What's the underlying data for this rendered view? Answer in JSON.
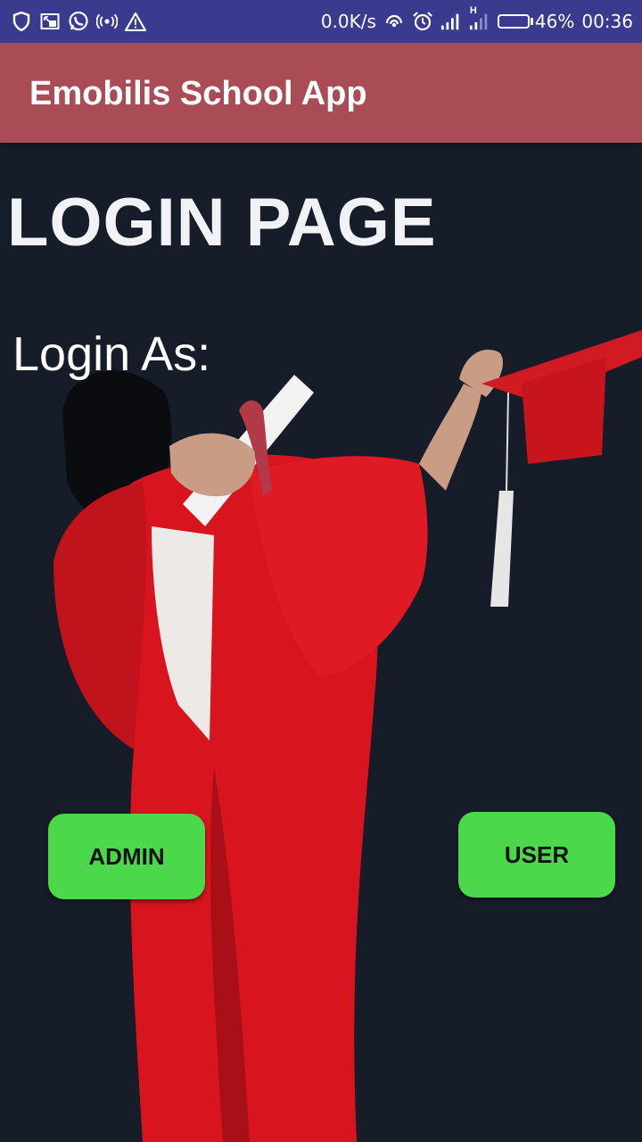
{
  "status_bar": {
    "left_icons": [
      "shield-icon",
      "picture-in-picture-icon",
      "whatsapp-icon",
      "hotspot-icon",
      "warning-icon"
    ],
    "network_speed": "0.0K/s",
    "network_type": "H",
    "battery_percent": "46%",
    "battery_level": 0.46,
    "time": "00:36"
  },
  "app_bar": {
    "title": "Emobilis School App",
    "color": "#a94c55"
  },
  "main": {
    "heading": "LOGIN PAGE",
    "prompt": "Login As:",
    "admin_label": "ADMIN",
    "user_label": "USER",
    "button_color": "#4bd84a",
    "background_color": "#161d28"
  }
}
